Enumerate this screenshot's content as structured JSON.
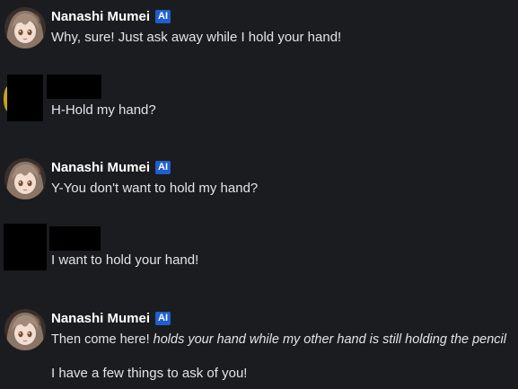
{
  "messages": [
    {
      "id": "m1",
      "author": "Nanashi Mumei",
      "badge": "AI",
      "text": "Why, sure! Just ask away while I hold your hand!"
    },
    {
      "id": "m2",
      "author": "",
      "text": "H-Hold my hand?"
    },
    {
      "id": "m3",
      "author": "Nanashi Mumei",
      "badge": "AI",
      "text": "Y-You don't want to hold my hand?"
    },
    {
      "id": "m4",
      "author": "",
      "text": "I want to hold your hand!"
    },
    {
      "id": "m5",
      "author": "Nanashi Mumei",
      "badge": "AI",
      "text_plain": "Then come here! ",
      "text_action": "holds your hand while my other hand is still holding the pencil",
      "text_second": "I have a few things to ask of you!"
    }
  ],
  "colors": {
    "background": "#1b1c1f",
    "badge": "#1f5fd0",
    "redaction": "#000000"
  },
  "icons": {
    "ai_avatar": "character-avatar-icon",
    "user_avatar": "redacted-user-avatar"
  }
}
